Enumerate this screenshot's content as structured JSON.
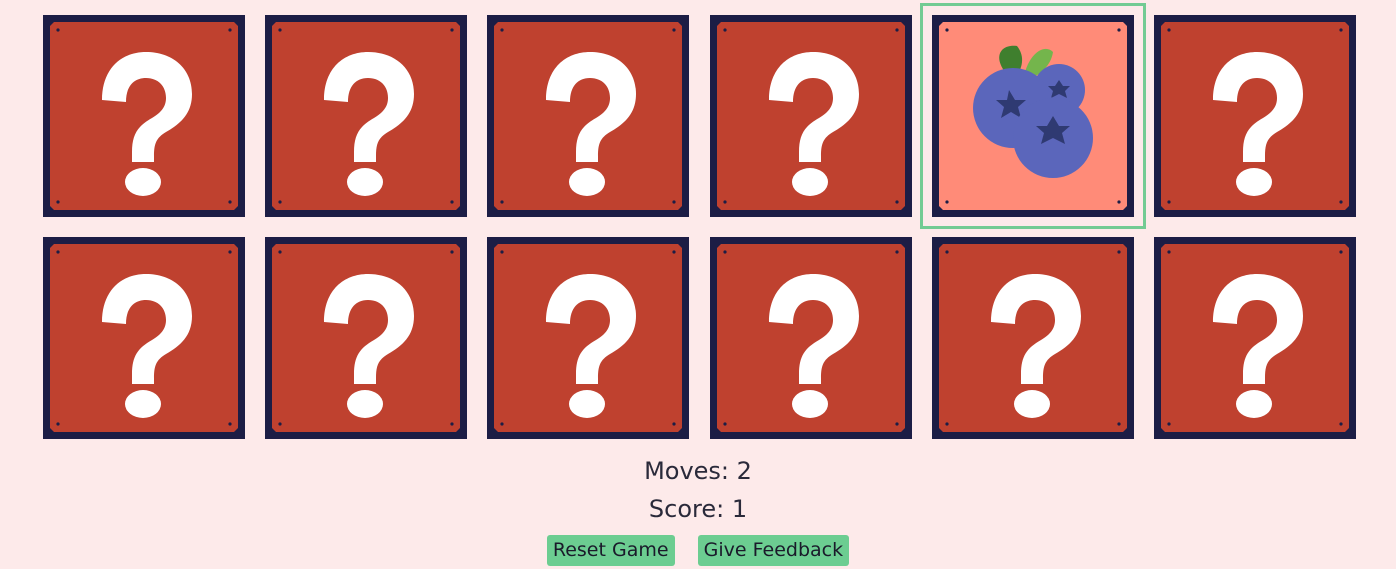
{
  "cards": [
    {
      "state": "hidden",
      "icon": "question-mark-icon"
    },
    {
      "state": "hidden",
      "icon": "question-mark-icon"
    },
    {
      "state": "hidden",
      "icon": "question-mark-icon"
    },
    {
      "state": "hidden",
      "icon": "question-mark-icon"
    },
    {
      "state": "revealed",
      "icon": "blueberries-icon",
      "selected": true
    },
    {
      "state": "hidden",
      "icon": "question-mark-icon"
    },
    {
      "state": "hidden",
      "icon": "question-mark-icon"
    },
    {
      "state": "hidden",
      "icon": "question-mark-icon"
    },
    {
      "state": "hidden",
      "icon": "question-mark-icon"
    },
    {
      "state": "hidden",
      "icon": "question-mark-icon"
    },
    {
      "state": "hidden",
      "icon": "question-mark-icon"
    },
    {
      "state": "hidden",
      "icon": "question-mark-icon"
    }
  ],
  "stats": {
    "moves_label": "Moves: ",
    "moves": "2",
    "score_label": "Score: ",
    "score": "1"
  },
  "buttons": {
    "reset_label": "Reset Game",
    "feedback_label": "Give Feedback"
  },
  "colors": {
    "background": "#fdeaea",
    "card_frame": "#1c1d45",
    "card_back": "#bf412f",
    "card_front": "#ff8b78",
    "selected_outline": "#73cb93",
    "button": "#6ccd91"
  }
}
